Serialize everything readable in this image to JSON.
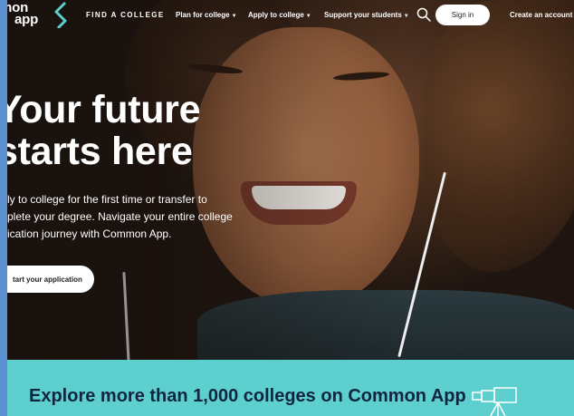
{
  "nav": {
    "logo_line1": "mon",
    "logo_line2": "app",
    "find_college": "FIND A COLLEGE",
    "plan": "Plan for college",
    "apply": "Apply to college",
    "support": "Support your students",
    "sign_in": "Sign in",
    "create_account": "Create an account",
    "icons": [
      "search-icon",
      "chevron-down-icon"
    ]
  },
  "hero": {
    "headline_line1": "Your future",
    "headline_line2": "starts here",
    "subtext": "ly to college for the first time or transfer to\nplete your degree. Navigate your entire college\nication journey with Common App.",
    "cta": "tart your application"
  },
  "band": {
    "title": "Explore more than 1,000 colleges on Common App",
    "icon": "telescope-icon"
  },
  "colors": {
    "band_bg": "#5ecfcf",
    "band_text": "#10263f",
    "window_bg": "#5a8fd0"
  }
}
